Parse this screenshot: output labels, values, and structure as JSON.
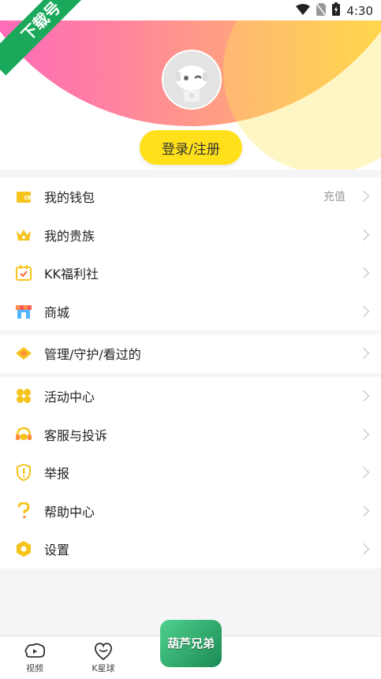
{
  "status": {
    "time": "4:30"
  },
  "badge": {
    "text": "下载号"
  },
  "profile": {
    "login_label": "登录/注册"
  },
  "menu_group1": [
    {
      "label": "我的钱包",
      "extra": "充值",
      "icon": "wallet-icon"
    },
    {
      "label": "我的贵族",
      "extra": "",
      "icon": "crown-icon"
    },
    {
      "label": "KK福利社",
      "extra": "",
      "icon": "calendar-check-icon"
    },
    {
      "label": "商城",
      "extra": "",
      "icon": "shop-icon"
    }
  ],
  "menu_group2": [
    {
      "label": "管理/守护/看过的",
      "icon": "diamond-icon"
    }
  ],
  "menu_group3": [
    {
      "label": "活动中心",
      "icon": "activity-icon"
    },
    {
      "label": "客服与投诉",
      "icon": "headset-icon"
    },
    {
      "label": "举报",
      "icon": "report-icon"
    },
    {
      "label": "帮助中心",
      "icon": "help-icon"
    },
    {
      "label": "设置",
      "icon": "settings-icon"
    }
  ],
  "nav": {
    "video_label": "视频",
    "planet_label": "K星球",
    "game_label": "葫芦兄弟"
  },
  "colors": {
    "accent": "#ffe01b",
    "icon_yellow": "#f6c31c"
  }
}
